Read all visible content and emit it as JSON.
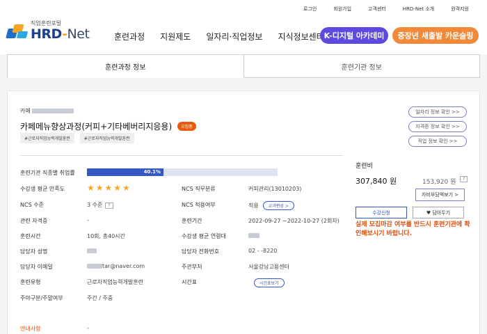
{
  "util_links": [
    "로그인",
    "회원가입",
    "고객센터",
    "HRD-Net 소개",
    "원격지원"
  ],
  "logo": {
    "sub": "직업훈련포털",
    "main_a": "HRD",
    "main_dash": "-",
    "main_b": "Net"
  },
  "gnb": [
    "훈련과정",
    "지원제도",
    "일자리·직업정보",
    "지식정보센터"
  ],
  "pills": {
    "kdigital": "K-디지털 아카데미",
    "counsel": "중장년 새출발 카운슬링"
  },
  "tabs": [
    "훈련과정 정보",
    "훈련기관 정보"
  ],
  "course": {
    "institution_prefix": "카페",
    "title": "카페메뉴향상과정(커피+기타베버리지응용)",
    "badge": "모집중",
    "tags": [
      "#근로자직업능력개발훈련",
      "#근로자직업능력개발훈련"
    ]
  },
  "side_links": [
    "일자리 정보 확인 >>",
    "자격증 정보 확인 >>",
    "직업 정보 확인 >>"
  ],
  "details": {
    "employment_label": "훈련기관 직종별 취업률",
    "employment_rate": "40.1%",
    "employment_fraction": 0.401,
    "satisfaction_label": "수강생 평균 만족도",
    "satisfaction_stars": "★★★★★",
    "ncs_level_label": "NCS 수준",
    "ncs_level_value": "3 수준",
    "license_label": "관련 자격증",
    "license_value": "-",
    "hours_label": "훈련시간",
    "hours_value": "10회, 총40시간",
    "manager_label": "담당자 성명",
    "email_label": "담당자 이메일",
    "email_value": "tar@naver.com",
    "type_label": "훈련유형",
    "type_value": "근로자직업능력개발훈련",
    "weekday_label": "주야구분/주말여부",
    "weekday_value": "주간 / 주중",
    "ncs_job_label": "NCS 직무분류",
    "ncs_job_value": "커피관리(13010203)",
    "ncs_apply_label": "NCS 적용여부",
    "ncs_apply_value": "적용",
    "curriculum_chip": "교과편성 >",
    "period_label": "훈련기간",
    "period_value": "2022-09-27 ~2022-10-27 (2회차)",
    "age_label": "수강생 평균 연령대",
    "phone_label": "담당자 전화번호",
    "phone_value": "02 -  -8220",
    "office_label": "주관부처",
    "office_value": "서울강남고용센터",
    "timetable_label": "시간표",
    "timetable_chip": "시간표보기"
  },
  "notice": {
    "label": "안내사항",
    "value": "-"
  },
  "price": {
    "title": "훈련비",
    "main": "307,840 원",
    "sub": "153,920 원",
    "q": "?",
    "selfpay": "자비부담액보기 >",
    "apply": "수강신청",
    "wish": "♥ 담아두기",
    "warn": "실제 모집마감 여부를 반드시 훈련기관에 확인해보시기 바랍니다."
  }
}
